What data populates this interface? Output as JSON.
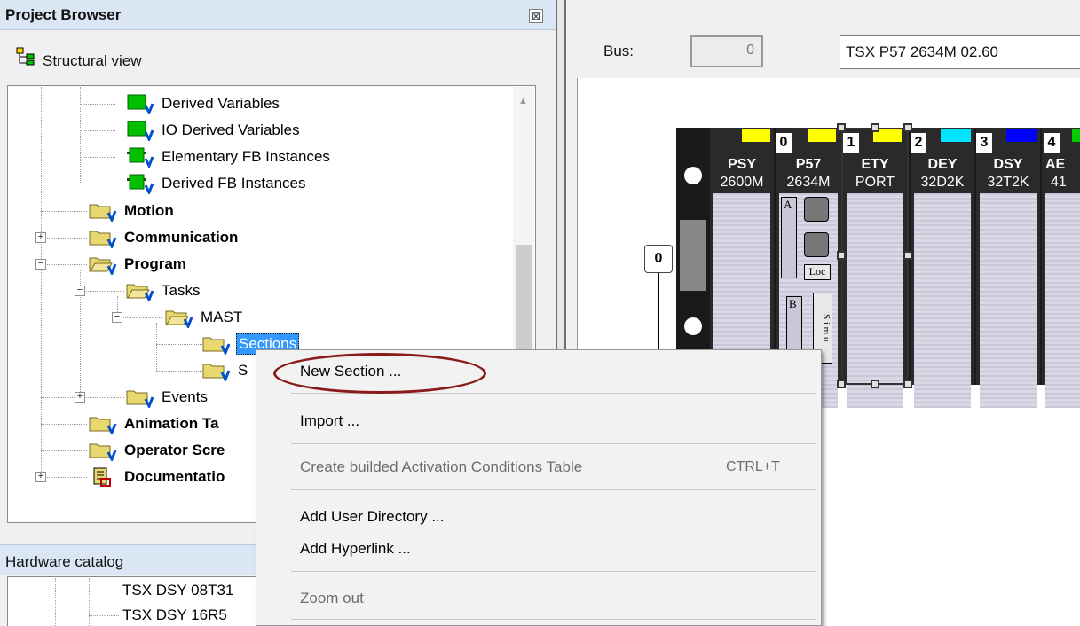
{
  "project_browser": {
    "title": "Project Browser",
    "close_glyph": "⊠",
    "view_label": "Structural view",
    "tree": [
      {
        "label": "Derived Variables",
        "bold": false
      },
      {
        "label": "IO Derived Variables",
        "bold": false
      },
      {
        "label": "Elementary FB Instances",
        "bold": false
      },
      {
        "label": "Derived FB Instances",
        "bold": false
      },
      {
        "label": "Motion",
        "bold": true
      },
      {
        "label": "Communication",
        "bold": true
      },
      {
        "label": "Program",
        "bold": true
      },
      {
        "label": "Tasks",
        "bold": false
      },
      {
        "label": "MAST",
        "bold": false
      },
      {
        "label": "Sections",
        "bold": false,
        "selected": true
      },
      {
        "label": "S",
        "bold": false
      },
      {
        "label": "Events",
        "bold": false
      },
      {
        "label": "Animation Ta",
        "bold": true
      },
      {
        "label": "Operator Scre",
        "bold": true
      },
      {
        "label": "Documentatio",
        "bold": true
      }
    ]
  },
  "hardware_catalog": {
    "title": "Hardware catalog",
    "items": [
      "TSX DSY 08T31",
      "TSX DSY 16R5"
    ]
  },
  "rack_panel": {
    "bus_label": "Bus:",
    "bus_value": "0",
    "cpu_value": "TSX P57 2634M   02.60",
    "rack_number": "0",
    "slots": [
      {
        "num": "",
        "line1": "PSY",
        "line2": "2600M",
        "led": "#ffff00"
      },
      {
        "num": "0",
        "line1": "P57",
        "line2": "2634M",
        "led": "#ffff00"
      },
      {
        "num": "1",
        "line1": "ETY",
        "line2": "PORT",
        "led": "#ffff00"
      },
      {
        "num": "2",
        "line1": "DEY",
        "line2": "32D2K",
        "led": "#00e5ff"
      },
      {
        "num": "3",
        "line1": "DSY",
        "line2": "32T2K",
        "led": "#0000ff"
      },
      {
        "num": "4",
        "line1": "AE",
        "line2": "41",
        "led": "#00cc00"
      }
    ],
    "cpu_panel": {
      "a": "A",
      "b": "B",
      "loc": "Loc",
      "sim": "S i m u"
    }
  },
  "context_menu": {
    "new_section": "New Section ...",
    "import": "Import ...",
    "create_table": "Create builded Activation Conditions Table",
    "create_table_shortcut": "CTRL+T",
    "add_user_dir": "Add User Directory ...",
    "add_hyperlink": "Add Hyperlink ...",
    "zoom_out": "Zoom out"
  },
  "colors": {
    "highlight_oval": "#8b1a1a",
    "selection": "#3399ff",
    "panel_title": "#dbe6f4"
  }
}
